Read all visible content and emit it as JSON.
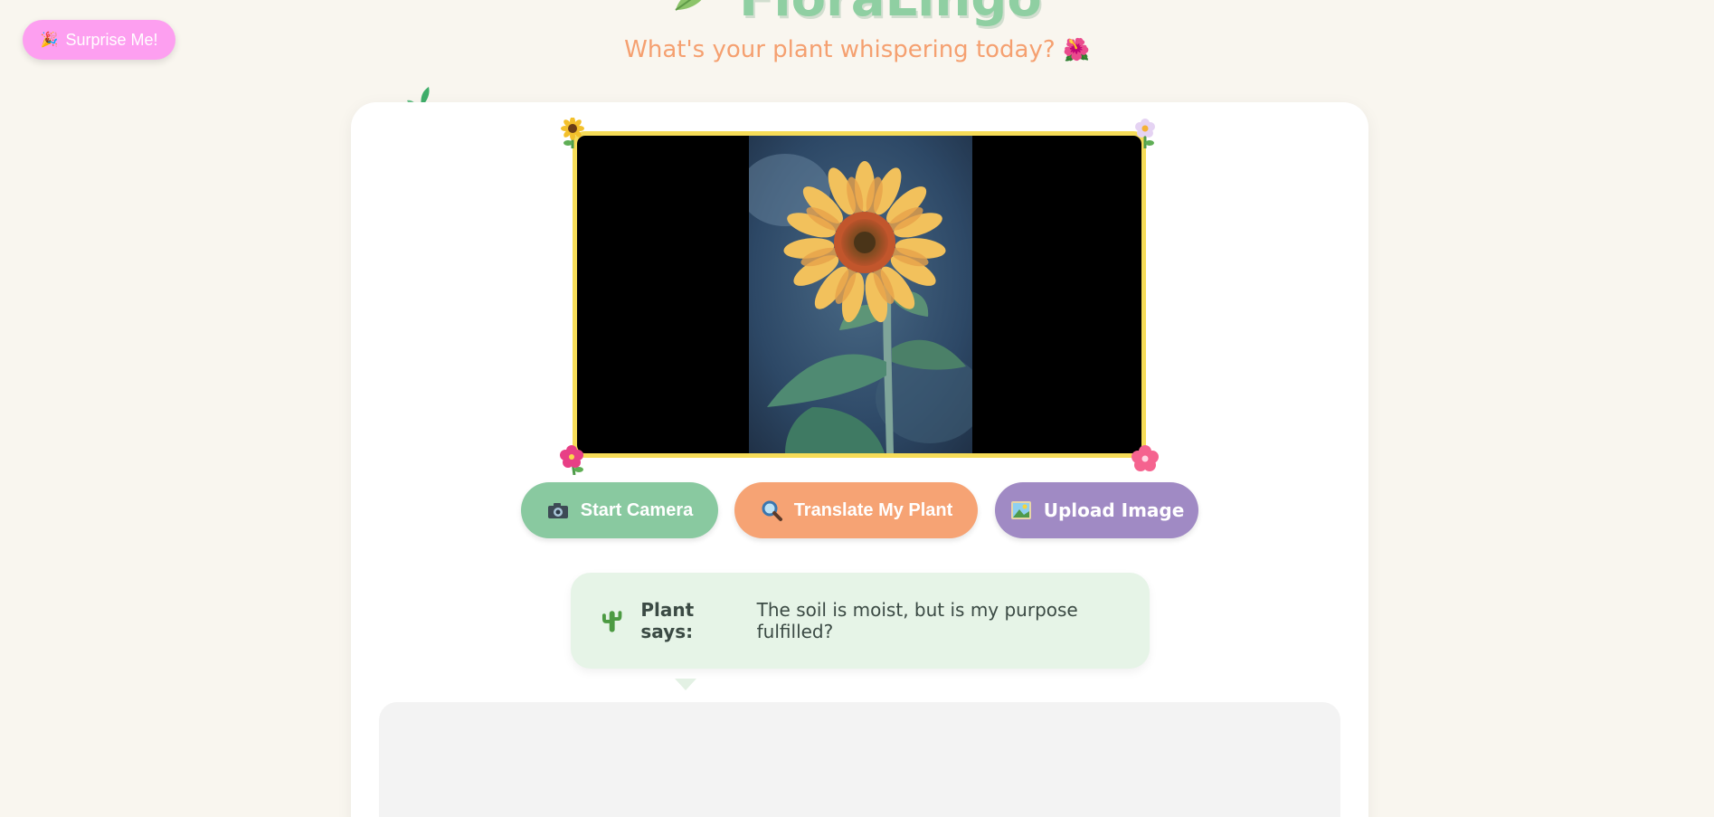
{
  "surprise_button": {
    "emoji": "🎉",
    "label": "Surprise Me!"
  },
  "header": {
    "title": "FloraLingo",
    "subtitle": "What's your plant whispering today?",
    "subtitle_icon": "🌺"
  },
  "camera": {
    "corner_icons": [
      "sunflower-icon",
      "blossom-icon",
      "hibiscus-icon",
      "flower-icon"
    ]
  },
  "buttons": {
    "start_camera": {
      "icon": "📷",
      "label": "Start Camera"
    },
    "translate": {
      "icon": "🔍",
      "label": "Translate My Plant"
    },
    "upload": {
      "icon": "🖼️",
      "label": "Upload Image"
    }
  },
  "speech": {
    "icon": "cactus-icon",
    "speaker": "Plant says:",
    "message": "The soil is moist, but is my purpose fulfilled?"
  },
  "colors": {
    "background": "#f9f6ef",
    "surprise": "#fd9ff0",
    "title": "#8fcfa2",
    "subtitle": "#f5a070",
    "frame_border": "#f6dc58",
    "camera_button": "#89c9a0",
    "translate_button": "#f6a374",
    "upload_button": "#a08ac4",
    "speech_bubble": "#e6f4e7"
  }
}
